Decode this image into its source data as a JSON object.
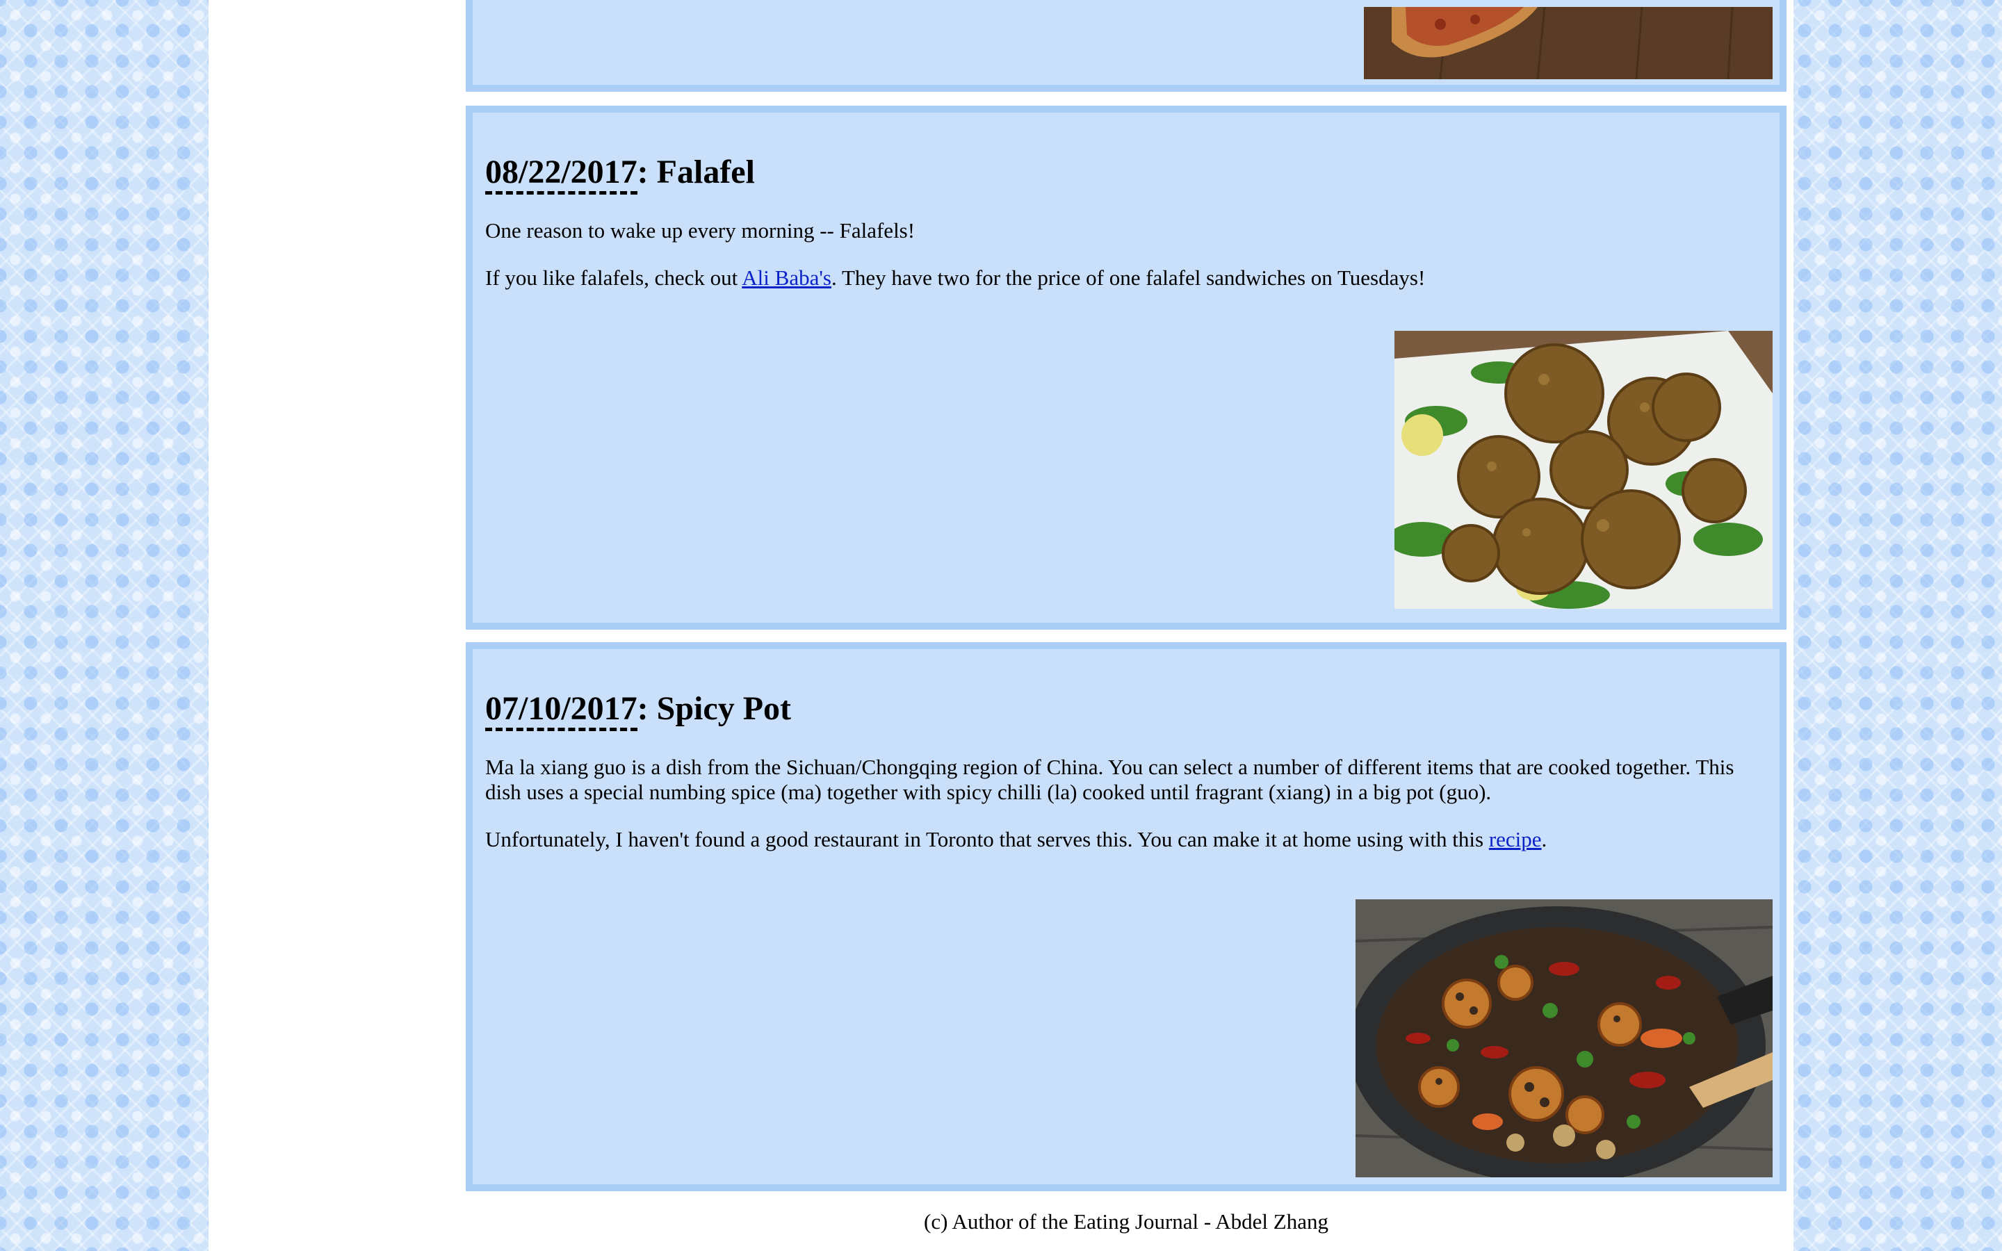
{
  "posts": [
    {
      "title_date": "08/22/2017",
      "title_sep": ": ",
      "title_name": "Falafel",
      "paragraphs": [
        {
          "text": "One reason to wake up every morning -- Falafels!"
        },
        {
          "before": "If you like falafels, check out ",
          "link": "Ali Baba's",
          "after": ". They have two for the price of one falafel sandwiches on Tuesdays!"
        }
      ],
      "image": "falafel-photo"
    },
    {
      "title_date": "07/10/2017",
      "title_sep": ": ",
      "title_name": "Spicy Pot",
      "paragraphs": [
        {
          "text": "Ma la xiang guo is a dish from the Sichuan/Chongqing region of China. You can select a number of different items that are cooked together. This dish uses a special numbing spice (ma) together with spicy chilli (la) cooked until fragrant (xiang) in a big pot (guo)."
        },
        {
          "before": "Unfortunately, I haven't found a good restaurant in Toronto that serves this. You can make it at home using with this ",
          "link": "recipe",
          "after": "."
        }
      ],
      "image": "spicy-pot-photo"
    }
  ],
  "previous_post_image": "pizza-photo",
  "footer": {
    "text": "(c) Author of the Eating Journal - Abdel Zhang"
  },
  "colors": {
    "post_bg": "#c9dffa",
    "post_border": "#aacdf6",
    "link": "#0b22c9"
  }
}
